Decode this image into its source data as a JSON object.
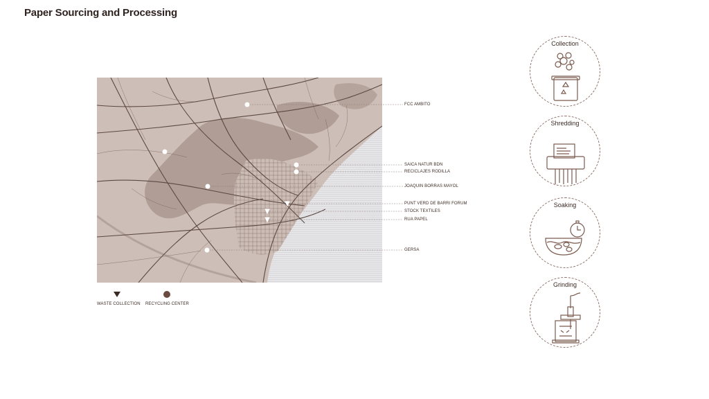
{
  "title": "Paper Sourcing and Processing",
  "map": {
    "locations": [
      {
        "name": "FCC AMBITO",
        "type": "recycling-center"
      },
      {
        "name": "SAICA NATUR BDN",
        "type": "recycling-center"
      },
      {
        "name": "RECICLAJES RODILLA",
        "type": "recycling-center"
      },
      {
        "name": "JOAQUIN BORRAS MAYOL",
        "type": "recycling-center"
      },
      {
        "name": "PUNT VERD DE BARRI FORUM",
        "type": "recycling-center"
      },
      {
        "name": "STOCK TEXTILES",
        "type": "waste-collection"
      },
      {
        "name": "RUA PAPEL",
        "type": "waste-collection"
      },
      {
        "name": "GERSA",
        "type": "recycling-center"
      }
    ],
    "legend": {
      "waste_collection": "WASTE COLLECTION",
      "recycling_center": "RECYCLING CENTER"
    },
    "colors": {
      "land": "#cbbcb5",
      "park": "#a8958c",
      "sea": "#e4e4e6",
      "roads": "#5a4640",
      "marker": "#ffffff",
      "accent": "#7a5a4d"
    }
  },
  "steps": [
    {
      "label": "Collection",
      "icon": "recycle-bin-icon"
    },
    {
      "label": "Shredding",
      "icon": "paper-shredder-icon"
    },
    {
      "label": "Soaking",
      "icon": "soaking-tub-timer-icon"
    },
    {
      "label": "Grinding",
      "icon": "grinder-icon"
    }
  ]
}
